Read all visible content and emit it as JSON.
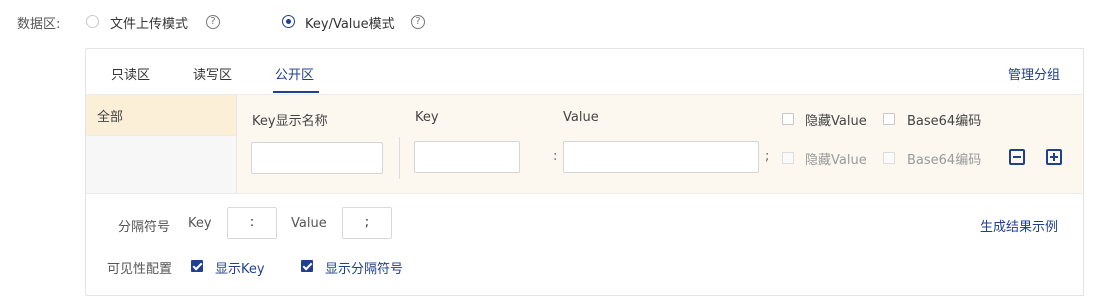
{
  "data_area": {
    "label": "数据区:",
    "mode_file": "文件上传模式",
    "mode_kv": "Key/Value模式",
    "help_glyph": "?"
  },
  "tabs": [
    {
      "label": "只读区",
      "active": false
    },
    {
      "label": "读写区",
      "active": false
    },
    {
      "label": "公开区",
      "active": true
    }
  ],
  "manage_group_link": "管理分组",
  "sidebar": {
    "items": [
      {
        "label": "全部",
        "selected": true
      }
    ]
  },
  "kv_table": {
    "headers": {
      "display_name": "Key显示名称",
      "key": "Key",
      "value": "Value",
      "hide_value": "隐藏Value",
      "base64": "Base64编码"
    },
    "row": {
      "display_name_value": "",
      "key_value": "",
      "value_value": "",
      "colon": ":",
      "semicolon": ";",
      "hide_value_label": "隐藏Value",
      "base64_label": "Base64编码"
    }
  },
  "separator": {
    "label": "分隔符号",
    "key_label": "Key",
    "key_value": ":",
    "value_label": "Value",
    "value_value": ";"
  },
  "generate_example_link": "生成结果示例",
  "visibility": {
    "label": "可见性配置",
    "show_key": "显示Key",
    "show_separator": "显示分隔符号"
  },
  "colors": {
    "accent": "#1f3f8f",
    "kv_bg": "#fcf7ef",
    "selected_item_bg": "#fcefd8"
  }
}
